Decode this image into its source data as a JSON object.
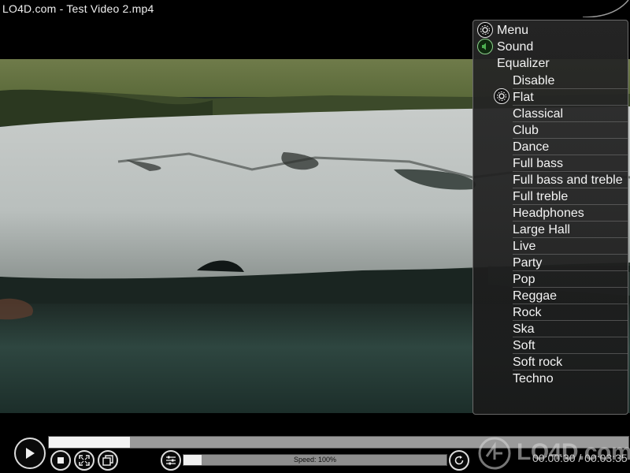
{
  "window": {
    "title_site": "LO4D.com",
    "title_separator": " - ",
    "title_file": "Test Video 2.mp4"
  },
  "menu": {
    "menu_label": "Menu",
    "sound_label": "Sound",
    "equalizer_label": "Equalizer",
    "selected_preset": "Flat",
    "presets": [
      "Disable",
      "Flat",
      "Classical",
      "Club",
      "Dance",
      "Full bass",
      "Full bass and treble",
      "Full treble",
      "Headphones",
      "Large Hall",
      "Live",
      "Party",
      "Pop",
      "Reggae",
      "Rock",
      "Ska",
      "Soft",
      "Soft rock",
      "Techno"
    ]
  },
  "playback": {
    "progress": 0.14,
    "speed_label": "Speed: 100%",
    "speed_fill": 0.07,
    "elapsed": "00:00:30",
    "time_separator": " / ",
    "duration": "00:03:35"
  },
  "icons": {
    "play": "play-icon",
    "stop": "stop-icon",
    "fullscreen": "fullscreen-icon",
    "snapshot": "snapshot-icon",
    "equalizer": "equalizer-icon",
    "loop": "loop-icon",
    "menu": "settings-gear-icon",
    "sound": "speaker-icon"
  },
  "watermark": {
    "text": "LO4D.com"
  },
  "colors": {
    "sound_icon": "#4caf50",
    "seek_fill": "#f3f3f3",
    "seek_track": "#9a9a9a"
  }
}
